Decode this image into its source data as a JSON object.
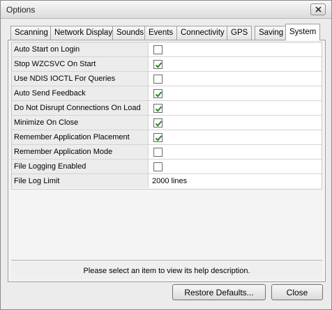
{
  "window": {
    "title": "Options"
  },
  "tabs": [
    {
      "label": "Scanning",
      "active": false
    },
    {
      "label": "Network Display",
      "active": false
    },
    {
      "label": "Sounds",
      "active": false
    },
    {
      "label": "Events",
      "active": false
    },
    {
      "label": "Connectivity",
      "active": false
    },
    {
      "label": "GPS",
      "active": false
    },
    {
      "label": "Saving",
      "active": false
    },
    {
      "label": "System",
      "active": true
    }
  ],
  "settings": [
    {
      "label": "Auto Start on Login",
      "type": "checkbox",
      "checked": false
    },
    {
      "label": "Stop WZCSVC On Start",
      "type": "checkbox",
      "checked": true
    },
    {
      "label": "Use NDIS IOCTL For Queries",
      "type": "checkbox",
      "checked": false
    },
    {
      "label": "Auto Send Feedback",
      "type": "checkbox",
      "checked": true
    },
    {
      "label": "Do Not Disrupt Connections On Load",
      "type": "checkbox",
      "checked": true
    },
    {
      "label": "Minimize On Close",
      "type": "checkbox",
      "checked": true
    },
    {
      "label": "Remember Application Placement",
      "type": "checkbox",
      "checked": true
    },
    {
      "label": "Remember Application Mode",
      "type": "checkbox",
      "checked": false
    },
    {
      "label": "File Logging Enabled",
      "type": "checkbox",
      "checked": false
    },
    {
      "label": "File Log Limit",
      "type": "text",
      "value": "2000 lines"
    }
  ],
  "help": {
    "text": "Please select an item to view its help description."
  },
  "buttons": {
    "restore": "Restore Defaults...",
    "close": "Close"
  },
  "colors": {
    "check": "#1f8a1f",
    "panel": "#f4f4f4"
  }
}
